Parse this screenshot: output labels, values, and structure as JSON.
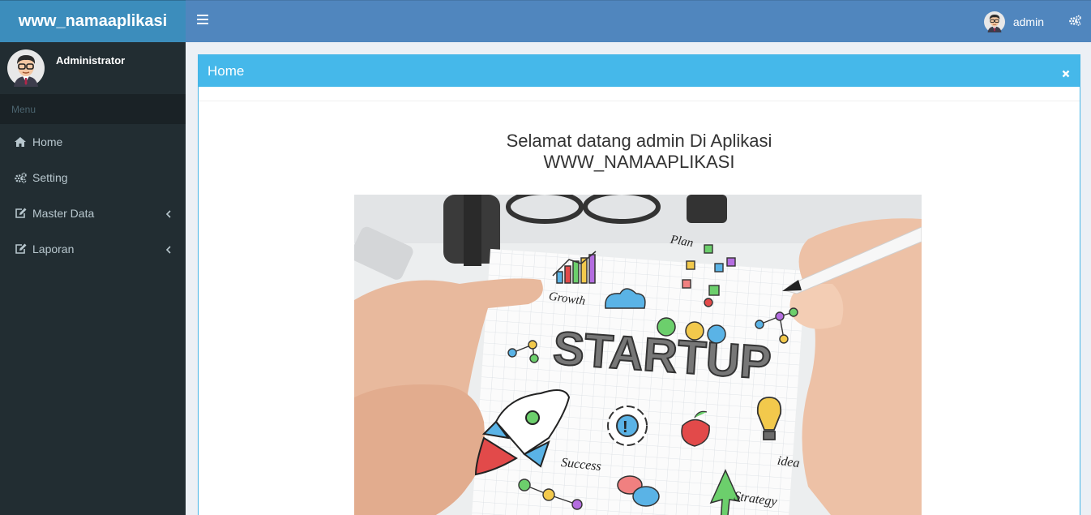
{
  "app": {
    "title": "www_namaaplikasi"
  },
  "header": {
    "user_name": "admin"
  },
  "sidebar": {
    "user_name": "Administrator",
    "menu_header": "Menu",
    "items": [
      {
        "label": "Home",
        "icon": "home-icon"
      },
      {
        "label": "Setting",
        "icon": "gears-icon"
      },
      {
        "label": "Master Data",
        "icon": "edit-icon",
        "has_submenu": true
      },
      {
        "label": "Laporan",
        "icon": "edit-icon",
        "has_submenu": true
      }
    ]
  },
  "main": {
    "box_title": "Home",
    "welcome_line1": "Selamat datang admin Di Aplikasi",
    "welcome_line2": "WWW_NAMAAPLIKASI",
    "hero_image": {
      "title_text": "STARTUP",
      "labels": [
        "Plan",
        "Growth",
        "Success",
        "idea",
        "Strategy"
      ]
    }
  },
  "colors": {
    "logo_bg": "#3c8dbc",
    "navbar_bg": "#5086be",
    "sidebar_bg": "#222d32",
    "box_header_bg": "#45b8ea"
  }
}
